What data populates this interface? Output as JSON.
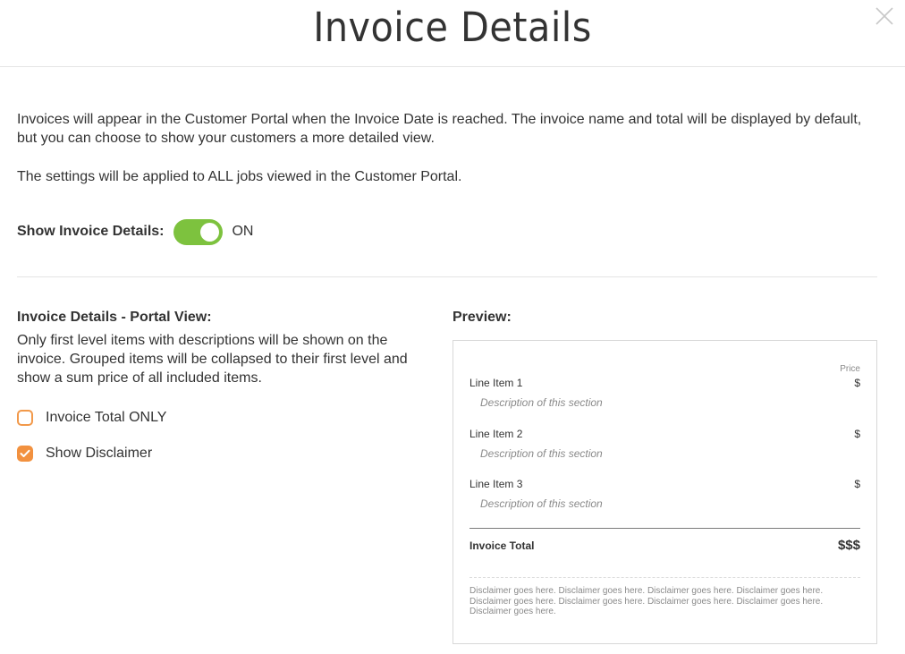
{
  "header": {
    "title": "Invoice Details",
    "close_icon": "close-icon"
  },
  "intro": {
    "text": "Invoices will appear in the Customer Portal when the Invoice Date is reached. The invoice name and total will be displayed by default, but you can choose to show your customers a more detailed view.",
    "settings_note": "The settings will be applied to ALL jobs viewed in the Customer Portal."
  },
  "toggle": {
    "label": "Show Invoice Details:",
    "state": "ON",
    "on": true
  },
  "portal_view": {
    "heading": "Invoice Details - Portal View:",
    "description": "Only first level items with descriptions will be shown on the invoice. Grouped items will be collapsed to their first level and show a sum price of all included items.",
    "options": [
      {
        "label": "Invoice Total ONLY",
        "checked": false
      },
      {
        "label": "Show Disclaimer",
        "checked": true
      }
    ]
  },
  "preview": {
    "heading": "Preview:",
    "price_header": "Price",
    "items": [
      {
        "name": "Line Item 1",
        "description": "Description of this section",
        "price": "$"
      },
      {
        "name": "Line Item 2",
        "description": "Description of this section",
        "price": "$"
      },
      {
        "name": "Line Item 3",
        "description": "Description of this section",
        "price": "$"
      }
    ],
    "total_label": "Invoice Total",
    "total_value": "$$$",
    "disclaimer": "Disclaimer goes here. Disclaimer goes here. Disclaimer goes here. Disclaimer goes here. Disclaimer goes here. Disclaimer goes here. Disclaimer goes here. Disclaimer goes here. Disclaimer goes here."
  },
  "colors": {
    "toggle_on": "#7dc23e",
    "checkbox_accent": "#f2913f",
    "text": "#333333",
    "muted": "#8a8a8a"
  }
}
